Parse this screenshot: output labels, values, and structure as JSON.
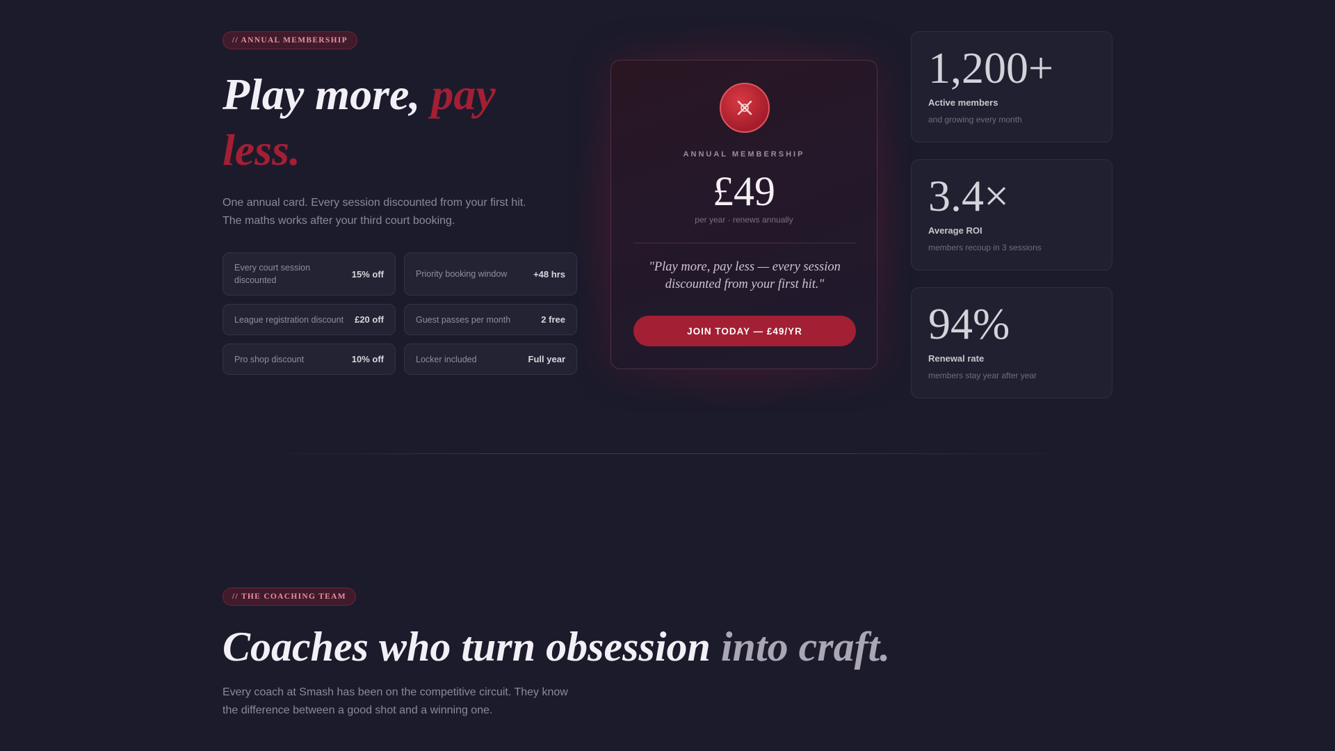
{
  "hero": {
    "eyebrow": "// ANNUAL MEMBERSHIP",
    "title_main": "Play more, ",
    "title_accent_1": "pay",
    "title_accent_2": "less.",
    "description_line1": "One annual card. Every session discounted from your first hit.",
    "description_line2": "The maths works after your third court booking.",
    "features": [
      {
        "label": "Every court session discounted",
        "value": "15% off"
      },
      {
        "label": "Priority booking window",
        "value": "+48 hrs"
      },
      {
        "label": "League registration discount",
        "value": "£20 off"
      },
      {
        "label": "Guest passes per month",
        "value": "2 free"
      },
      {
        "label": "Pro shop discount",
        "value": "10% off"
      },
      {
        "label": "Locker included",
        "value": "Full year"
      }
    ]
  },
  "card": {
    "icon": "crossed-rackets-icon",
    "eyebrow": "ANNUAL MEMBERSHIP",
    "price": "£49",
    "subtext": "per year · renews annually",
    "quote": "\"Play more, pay less — every session discounted from your first hit.\"",
    "cta_label": "JOIN TODAY — £49/YR"
  },
  "stats": [
    {
      "value": "1,200+",
      "label": "Active members",
      "caption": "and growing every month"
    },
    {
      "value": "3.4×",
      "label": "Average ROI",
      "caption": "members recoup in 3 sessions"
    },
    {
      "value": "94%",
      "label": "Renewal rate",
      "caption": "members stay year after year"
    }
  ],
  "coaching": {
    "eyebrow": "// THE COACHING TEAM",
    "title_main": "Coaches who turn obsession ",
    "title_accent": "into craft.",
    "description_line1": "Every coach at Smash has been on the competitive circuit. They know",
    "description_line2": "the difference between a good shot and a winning one."
  },
  "colors": {
    "background": "#1b1b2b",
    "accent": "#a31f34",
    "card": "#232333"
  }
}
